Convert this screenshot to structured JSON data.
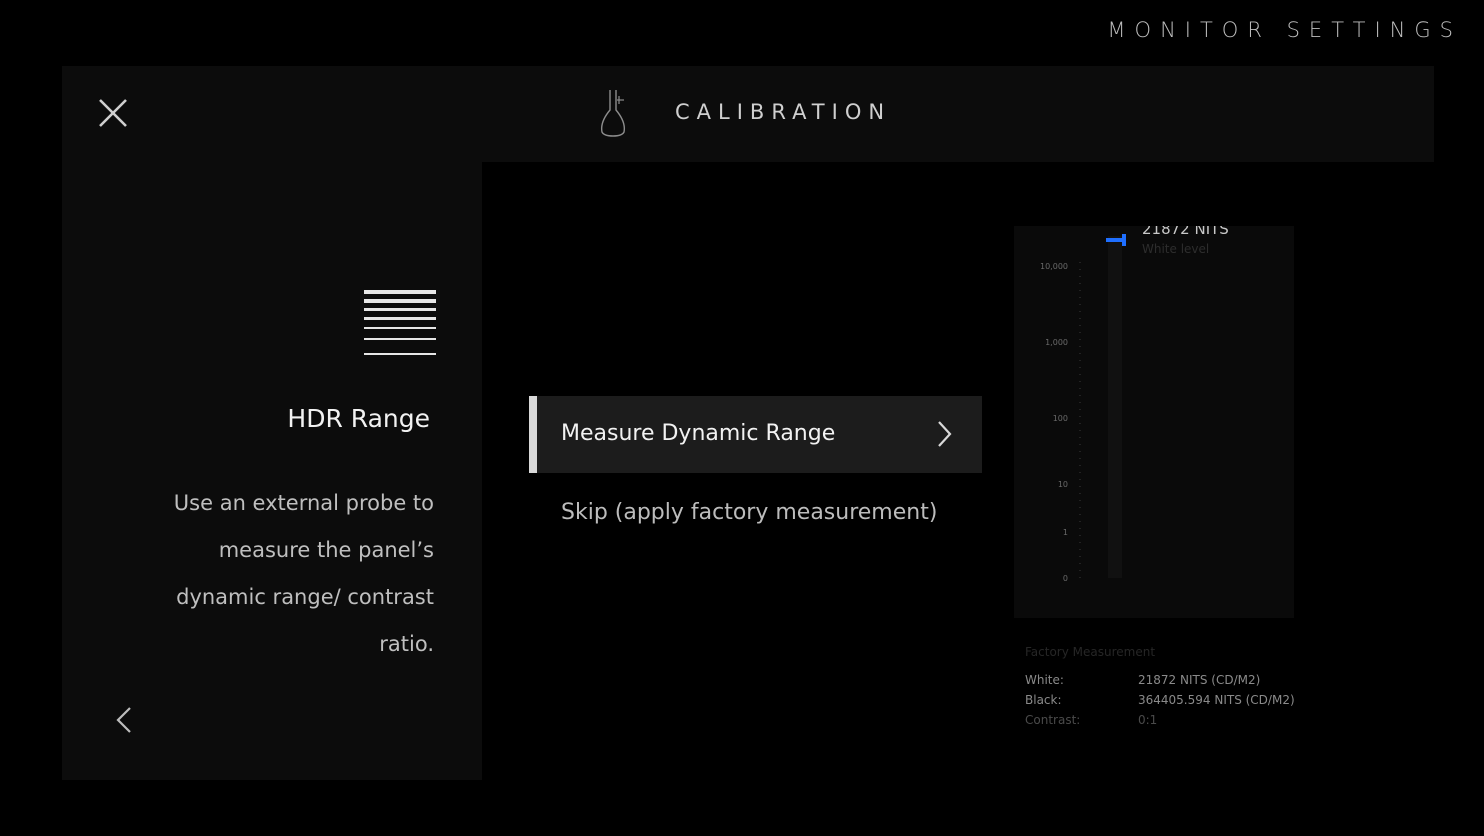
{
  "screen_title": "MONITOR SETTINGS",
  "header": {
    "title": "CALIBRATION"
  },
  "section": {
    "title": "HDR Range",
    "description": "Use an external probe to measure the panel’s dynamic range/ contrast ratio."
  },
  "menu": [
    {
      "label": "Measure Dynamic Range",
      "selected": true
    },
    {
      "label": "Skip (apply factory measurement)",
      "selected": false
    }
  ],
  "meter": {
    "readout": "21872 NITS",
    "sub": "White level",
    "ticks": [
      "10,000",
      "1,000",
      "100",
      "10",
      "1",
      "0"
    ],
    "accent": "#1f6fff"
  },
  "factory": {
    "heading": "Factory Measurement",
    "rows": [
      {
        "key": "White:",
        "value": "21872 NITS (CD/M2)"
      },
      {
        "key": "Black:",
        "value": "364405.594 NITS (CD/M2)"
      },
      {
        "key": "Contrast:",
        "value": "0:1"
      }
    ]
  }
}
